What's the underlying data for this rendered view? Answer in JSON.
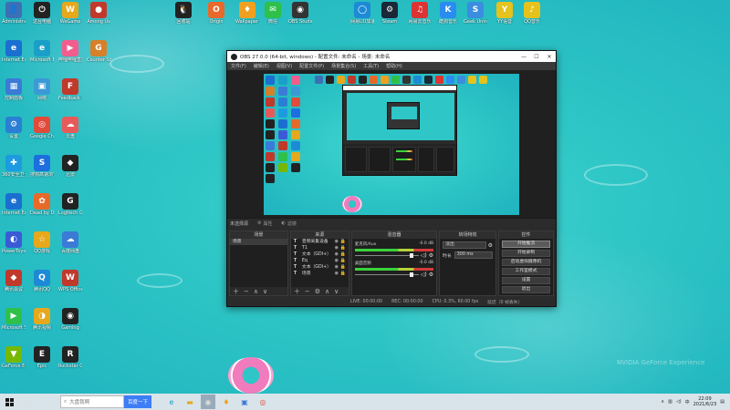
{
  "desktop": {
    "icons": [
      {
        "label": "Administrator",
        "glyph": "👤",
        "color": "#3d6fb5"
      },
      {
        "label": "这台电脑",
        "glyph": "⏻",
        "color": "#222"
      },
      {
        "label": "WeGame",
        "glyph": "W",
        "color": "#e6a81c"
      },
      {
        "label": "Among Us",
        "glyph": "●",
        "color": "#c0392b"
      },
      {
        "label": "回收站",
        "glyph": "🐧",
        "color": "#222"
      },
      {
        "label": "Origin",
        "glyph": "O",
        "color": "#e8692a"
      },
      {
        "label": "Wallpaper Engine",
        "glyph": "♦",
        "color": "#f0a020"
      },
      {
        "label": "微信",
        "glyph": "✉",
        "color": "#2ec04a"
      },
      {
        "label": "OBS Studio",
        "glyph": "◉",
        "color": "#333"
      },
      {
        "label": "网易UU加速器",
        "glyph": "◯",
        "color": "#1d8ad6"
      },
      {
        "label": "Steam",
        "glyph": "⚙",
        "color": "#1b2838"
      },
      {
        "label": "网易云音乐",
        "glyph": "♫",
        "color": "#d33"
      },
      {
        "label": "酷狗音乐",
        "glyph": "K",
        "color": "#2a8cf0"
      },
      {
        "label": "Geek Uninstaller",
        "glyph": "S",
        "color": "#3b8de0"
      },
      {
        "label": "YY语音",
        "glyph": "Y",
        "color": "#e6c21c"
      },
      {
        "label": "QQ音乐",
        "glyph": "♪",
        "color": "#e6c21c"
      },
      {
        "label": "Internet Explorer",
        "glyph": "e",
        "color": "#1a6fd0"
      },
      {
        "label": "Microsoft Edge",
        "glyph": "e",
        "color": "#1aa0c8"
      },
      {
        "label": "哔哩哔哩直播姬",
        "glyph": "▶",
        "color": "#f25d8e"
      },
      {
        "label": "Counter-Strike",
        "glyph": "G",
        "color": "#d6802a"
      },
      {
        "label": "控制面板",
        "glyph": "▦",
        "color": "#3b7bd6"
      },
      {
        "label": "网络",
        "glyph": "▣",
        "color": "#3b9ad6"
      },
      {
        "label": "Feedback Hub",
        "glyph": "F",
        "color": "#c0392b"
      },
      {
        "label": "设置",
        "glyph": "⚙",
        "color": "#2a7fd4"
      },
      {
        "label": "Google Chrome",
        "glyph": "◎",
        "color": "#e04b3a"
      },
      {
        "label": "云盘",
        "glyph": "☁",
        "color": "#e85a5a"
      },
      {
        "label": "360安全卫士",
        "glyph": "✚",
        "color": "#1d9be0"
      },
      {
        "label": "搜狗高速浏览器",
        "glyph": "S",
        "color": "#1d6fe0"
      },
      {
        "label": "迅雷",
        "glyph": "◆",
        "color": "#222"
      },
      {
        "label": "Internet Explorer",
        "glyph": "e",
        "color": "#1a6fd0"
      },
      {
        "label": "Dead by Daylight",
        "glyph": "✿",
        "color": "#e86a2a"
      },
      {
        "label": "Logitech G HUB",
        "glyph": "G",
        "color": "#222"
      },
      {
        "label": "PowerToys",
        "glyph": "◐",
        "color": "#3b5bd6"
      },
      {
        "label": "QQ游戏",
        "glyph": "☆",
        "color": "#e6a81c"
      },
      {
        "label": "百度网盘",
        "glyph": "☁",
        "color": "#3b7bd6"
      },
      {
        "label": "腾讯会议",
        "glyph": "◆",
        "color": "#c0392b"
      },
      {
        "label": "腾讯QQ",
        "glyph": "Q",
        "color": "#1d8ad6"
      },
      {
        "label": "WPS Office",
        "glyph": "W",
        "color": "#c0392b"
      },
      {
        "label": "Microsoft Store",
        "glyph": "▶",
        "color": "#2ec04a"
      },
      {
        "label": "腾讯视频",
        "glyph": "◑",
        "color": "#e6a81c"
      },
      {
        "label": "Gaming",
        "glyph": "◉",
        "color": "#222"
      },
      {
        "label": "GeForce Experience",
        "glyph": "▼",
        "color": "#76b900"
      },
      {
        "label": "Epic",
        "glyph": "E",
        "color": "#222"
      },
      {
        "label": "Rockstar Games",
        "glyph": "R",
        "color": "#222"
      }
    ],
    "watermark": "NVIDIA GeForce Experience"
  },
  "obs": {
    "title": "OBS 27.0.0 (64-bit, windows) - 配置文件: 未命名 - 场景: 未命名",
    "menu": [
      "文件(F)",
      "编辑(E)",
      "视图(V)",
      "配置文件(P)",
      "场景集合(S)",
      "工具(T)",
      "帮助(H)"
    ],
    "subbar_label": "未选择源",
    "subbar_props": "属性",
    "subbar_filters": "滤镜",
    "docks": {
      "scenes_title": "场景",
      "scenes": [
        "场景"
      ],
      "sources_title": "来源",
      "sources": [
        "音频采集设备",
        "T1",
        "文本（GDI+）",
        "Eq",
        "文本（GDI+）",
        "场景"
      ],
      "mixer_title": "混音器",
      "mixer_tracks": [
        {
          "name": "麦克风/Aux",
          "db": "-0.0 dB"
        },
        {
          "name": "桌面音频",
          "db": "-0.0 dB"
        }
      ],
      "transitions_title": "转场特效",
      "transition_type": "淡出",
      "duration_label": "时长",
      "duration_value": "300 ms",
      "controls_title": "控件",
      "controls": [
        "开始推流",
        "开始录制",
        "启动虚拟摄像机",
        "工作室模式",
        "设置",
        "退出"
      ]
    },
    "status": {
      "live": "LIVE: 00:00:00",
      "rec": "REC: 00:00:00",
      "cpu": "CPU: 0.3%, 60.00 fps",
      "dropped": "延迟（0 帧丢失）"
    }
  },
  "taskbar": {
    "search_placeholder": "大盘我啊",
    "search_button": "百度一下",
    "tray_lang": "中",
    "time": "22:09",
    "date": "2021/6/23"
  }
}
